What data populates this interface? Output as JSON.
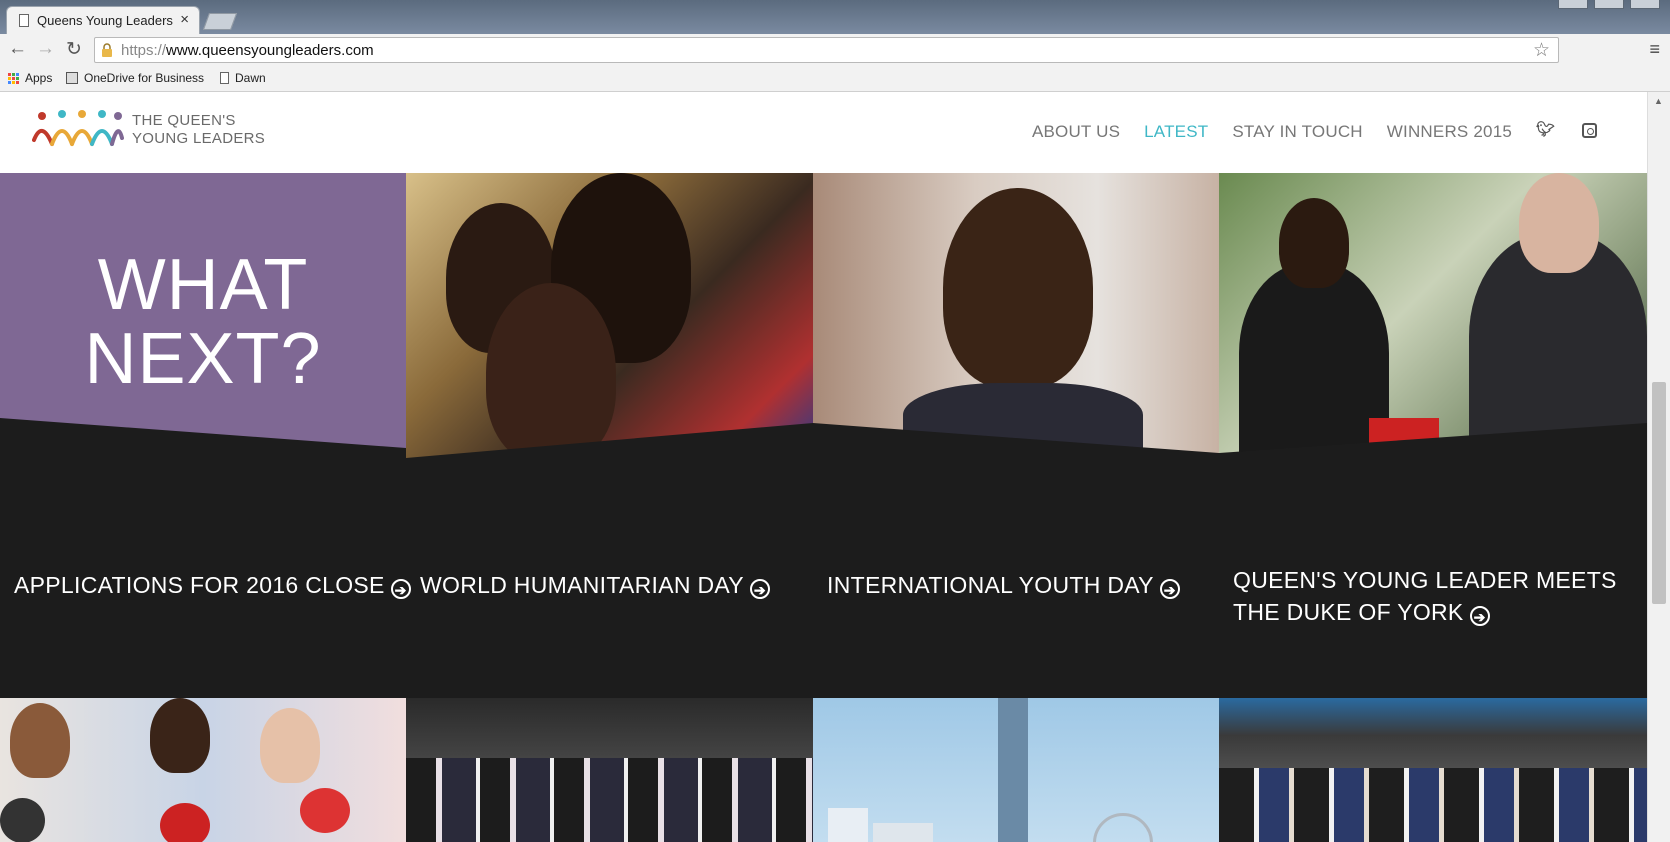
{
  "browser": {
    "tab_title": "Queens Young Leaders",
    "tab_close": "×",
    "url_scheme": "https://",
    "url_host": "www.queensyoungleaders.com",
    "bookmarks": [
      {
        "label": "Apps",
        "icon": "apps-grid-icon"
      },
      {
        "label": "OneDrive for Business",
        "icon": "onedrive-icon"
      },
      {
        "label": "Dawn",
        "icon": "page-icon"
      }
    ]
  },
  "site": {
    "logo_line1": "THE QUEEN'S",
    "logo_line2": "YOUNG LEADERS",
    "nav": [
      {
        "label": "ABOUT US",
        "active": false
      },
      {
        "label": "LATEST",
        "active": true
      },
      {
        "label": "STAY IN TOUCH",
        "active": false
      },
      {
        "label": "WINNERS 2015",
        "active": false
      }
    ],
    "accent_color": "#3fb7c6",
    "purple_color": "#7f6894"
  },
  "tiles": {
    "whatnext_line1": "WHAT",
    "whatnext_line2": "NEXT?",
    "captions": [
      "APPLICATIONS FOR 2016 CLOSE",
      "WORLD HUMANITARIAN DAY",
      "INTERNATIONAL YOUTH DAY",
      "QUEEN'S YOUNG LEADER MEETS",
      "THE DUKE OF YORK"
    ],
    "arrow_glyph": "➔"
  }
}
